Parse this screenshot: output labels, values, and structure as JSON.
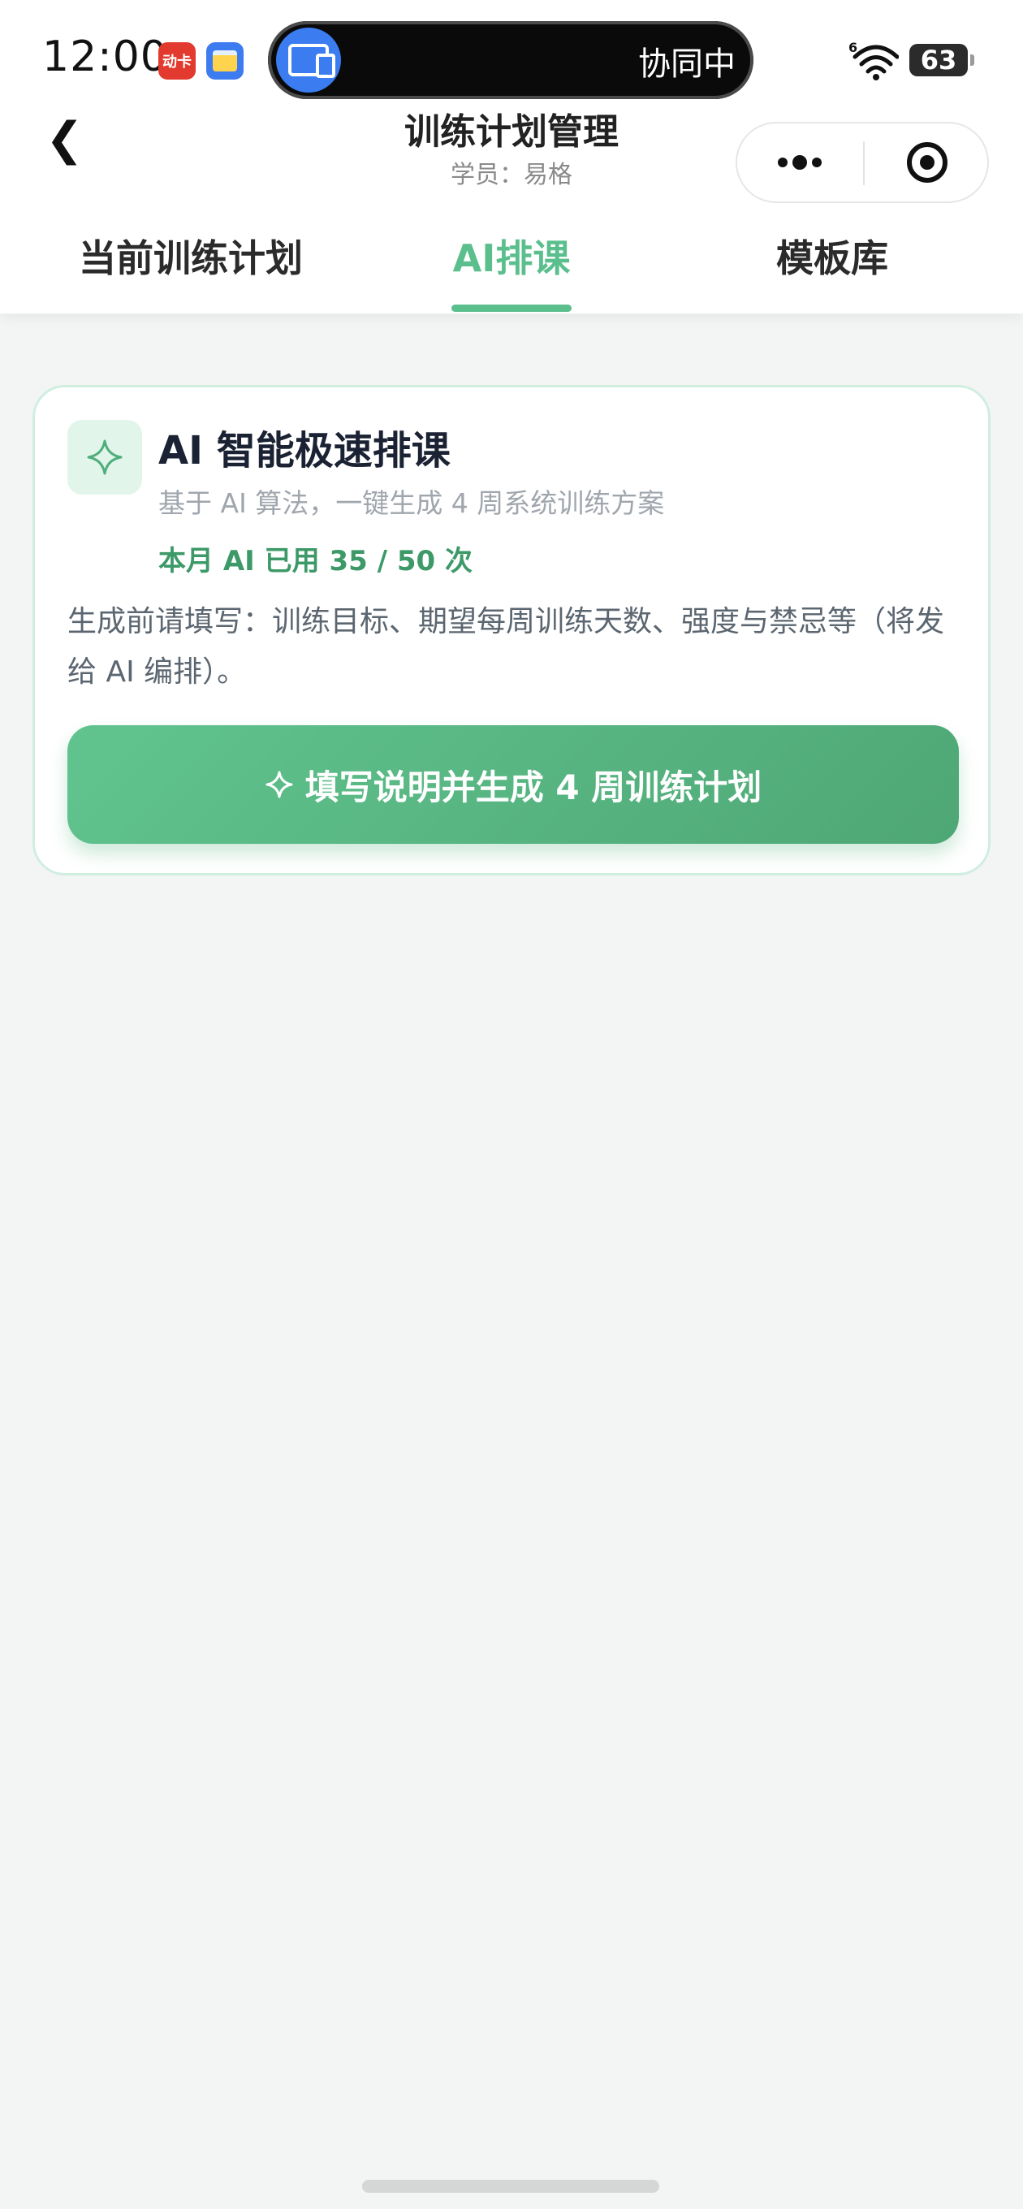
{
  "status_bar": {
    "time": "12:00",
    "app_badges": [
      "动卡",
      "wallet"
    ],
    "cooperate_label": "协同中",
    "battery": "63",
    "icons": [
      "cooperate-devices-icon",
      "wifi-icon",
      "battery-icon"
    ]
  },
  "nav": {
    "back_icon": "❮",
    "title": "训练计划管理",
    "subtitle": "学员：易格",
    "capsule_icons": [
      "more-dots-icon",
      "target-circle-icon"
    ]
  },
  "tabs": [
    {
      "label": "当前训练计划",
      "active": false
    },
    {
      "label": "AI排课",
      "active": true
    },
    {
      "label": "模板库",
      "active": false
    }
  ],
  "ai_card": {
    "icon": "sparkle-icon",
    "title": "AI 智能极速排课",
    "description": "基于 AI 算法，一键生成 4 周系统训练方案",
    "usage": "本月 AI 已用 35 / 50 次",
    "note": "生成前请填写：训练目标、期望每周训练天数、强度与禁忌等（将发给 AI 编排）。",
    "button_label": "填写说明并生成 4 周训练计划"
  },
  "colors": {
    "accent": "#5bbf8d",
    "accent_dark": "#3d9968",
    "background": "#f3f5f4"
  }
}
